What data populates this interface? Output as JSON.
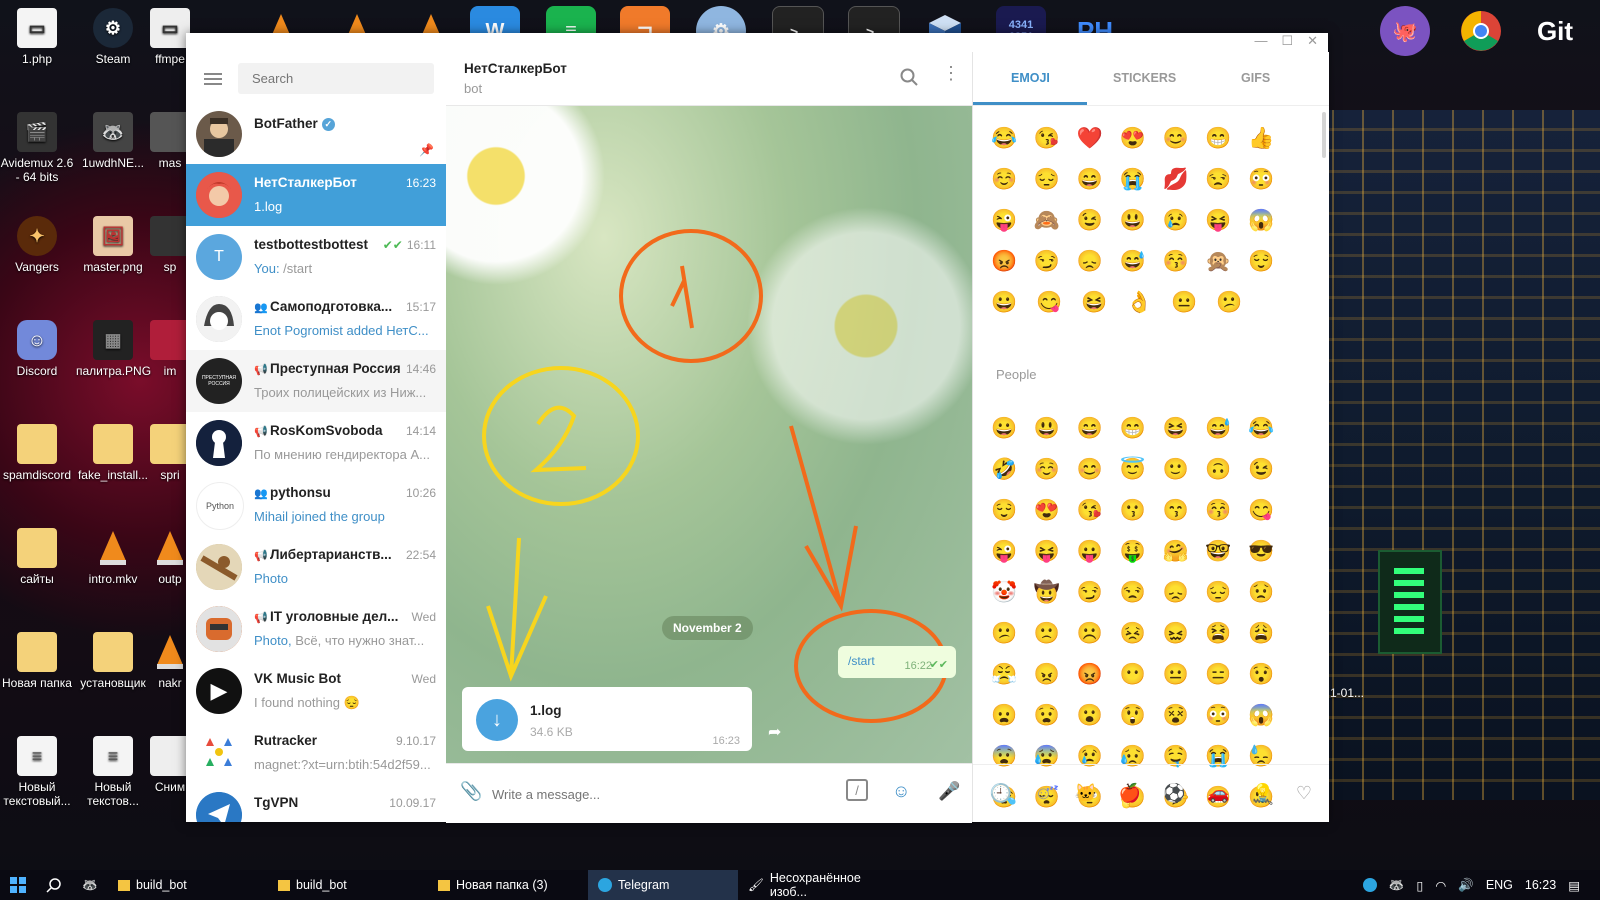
{
  "desktop": {
    "icons_left": [
      {
        "label": "1.php",
        "icon": "file-icon"
      },
      {
        "label": "Steam",
        "icon": "steam-icon"
      },
      {
        "label": "ffmpe",
        "icon": "file-icon"
      },
      {
        "label": "Avidemux 2.6 - 64 bits",
        "icon": "clapper-icon"
      },
      {
        "label": "1uwdhNE...",
        "icon": "image-icon"
      },
      {
        "label": "mas",
        "icon": "file-icon"
      },
      {
        "label": "Vangers",
        "icon": "game-icon"
      },
      {
        "label": "master.png",
        "icon": "image-icon"
      },
      {
        "label": "sp",
        "icon": "file-icon"
      },
      {
        "label": "Discord",
        "icon": "discord-icon"
      },
      {
        "label": "палитра.PNG",
        "icon": "image-icon"
      },
      {
        "label": "im",
        "icon": "file-icon"
      },
      {
        "label": "spamdiscord",
        "icon": "folder-icon"
      },
      {
        "label": "fake_install...",
        "icon": "folder-icon"
      },
      {
        "label": "spri",
        "icon": "folder-icon"
      },
      {
        "label": "сайты",
        "icon": "folder-icon"
      },
      {
        "label": "intro.mkv",
        "icon": "vlc-icon"
      },
      {
        "label": "outp",
        "icon": "vlc-icon"
      },
      {
        "label": "Новая папка",
        "icon": "folder-icon"
      },
      {
        "label": "установщик",
        "icon": "folder-icon"
      },
      {
        "label": "nakr",
        "icon": "vlc-icon"
      },
      {
        "label": "Новый текстовый...",
        "icon": "file-icon"
      },
      {
        "label": "Новый текстов...",
        "icon": "file-icon"
      },
      {
        "label": "Сним",
        "icon": "file-icon"
      }
    ],
    "right_label": "1-01...",
    "top_icon_git": "Git",
    "top_icon_numbers": "4341 6851"
  },
  "telegram": {
    "search_placeholder": "Search",
    "chats": [
      {
        "name": "BotFather",
        "time": "",
        "preview": "",
        "verified": true,
        "pinned": true,
        "avatar_color": "#6b5a4a",
        "avatar_text": ""
      },
      {
        "name": "НетСталкерБот",
        "time": "16:23",
        "preview": "1.log",
        "active": true,
        "avatar_color": "#d9534f",
        "avatar_text": ""
      },
      {
        "name": "testbottestbottest",
        "time": "16:11",
        "preview_prefix": "You:",
        "preview": " /start",
        "avatar_color": "#5ba7de",
        "avatar_text": "T"
      },
      {
        "name": "Самоподготовка...",
        "time": "15:17",
        "preview": "Enot Pogromist added НетС...",
        "type": "group",
        "avatar_color": "#cccccc",
        "avatar_text": ""
      },
      {
        "name": "Преступная Россия",
        "time": "14:46",
        "preview": "Троих полицейских из Ниж...",
        "type": "channel",
        "avatar_color": "#222222",
        "avatar_text": "ПРЕСТУПНАЯ РОССИЯ"
      },
      {
        "name": "RosKomSvoboda",
        "time": "14:14",
        "preview": "По мнению гендиректора А...",
        "type": "channel",
        "avatar_color": "#1b2a4a",
        "avatar_text": ""
      },
      {
        "name": "pythonsu",
        "time": "10:26",
        "preview": "Mihail joined the group",
        "type": "group",
        "avatar_color": "#ffffff",
        "avatar_text": "Python"
      },
      {
        "name": "Либертарианств...",
        "time": "22:54",
        "preview": "Photo",
        "type": "channel",
        "avatar_color": "#c9b48a",
        "avatar_text": ""
      },
      {
        "name": "IT уголовные дел...",
        "time": "Wed",
        "preview_prefix": "Photo,",
        "preview": " Всё, что нужно знат...",
        "type": "channel",
        "avatar_color": "#d96b2e",
        "avatar_text": ""
      },
      {
        "name": "VK Music Bot",
        "time": "Wed",
        "preview": "I found nothing 😔",
        "avatar_color": "#111111",
        "avatar_text": "▶"
      },
      {
        "name": "Rutracker",
        "time": "9.10.17",
        "preview": "magnet:?xt=urn:btih:54d2f59...",
        "avatar_color": "#ffffff",
        "avatar_text": ""
      },
      {
        "name": "TgVPN",
        "time": "10.09.17",
        "preview": "",
        "avatar_color": "#2a78c4",
        "avatar_text": ""
      }
    ],
    "chat": {
      "title": "НетСталкерБот",
      "subtitle": "bot",
      "date_separator": "November 2",
      "messages": [
        {
          "direction": "out",
          "text": "/start",
          "time": "16:22",
          "read": true
        },
        {
          "direction": "in",
          "file_name": "1.log",
          "file_size": "34.6 KB",
          "time": "16:23"
        }
      ],
      "compose_placeholder": "Write a message...",
      "annotations": [
        "1",
        "2"
      ]
    },
    "emoji_panel": {
      "tabs": [
        "EMOJI",
        "STICKERS",
        "GIFS"
      ],
      "active_tab": "EMOJI",
      "recent": [
        [
          "😂",
          "😘",
          "❤️",
          "😍",
          "😊",
          "😁",
          "👍"
        ],
        [
          "☺️",
          "😔",
          "😄",
          "😭",
          "💋",
          "😒",
          "😳"
        ],
        [
          "😜",
          "🙈",
          "😉",
          "😃",
          "😢",
          "😝",
          "😱"
        ],
        [
          "😡",
          "😏",
          "😞",
          "😅",
          "😚",
          "🙊",
          "😌"
        ],
        [
          "😀",
          "😋",
          "😆",
          "👌",
          "😐",
          "😕"
        ]
      ],
      "people_label": "People",
      "people": [
        [
          "😀",
          "😃",
          "😄",
          "😁",
          "😆",
          "😅",
          "😂"
        ],
        [
          "🤣",
          "☺️",
          "😊",
          "😇",
          "🙂",
          "🙃",
          "😉"
        ],
        [
          "😌",
          "😍",
          "😘",
          "😗",
          "😙",
          "😚",
          "😋"
        ],
        [
          "😜",
          "😝",
          "😛",
          "🤑",
          "🤗",
          "🤓",
          "😎"
        ],
        [
          "🤡",
          "🤠",
          "😏",
          "😒",
          "😞",
          "😔",
          "😟"
        ],
        [
          "😕",
          "🙁",
          "☹️",
          "😣",
          "😖",
          "😫",
          "😩"
        ],
        [
          "😤",
          "😠",
          "😡",
          "😶",
          "😐",
          "😑",
          "😯"
        ],
        [
          "😦",
          "😧",
          "😮",
          "😲",
          "😵",
          "😳",
          "😱"
        ],
        [
          "😨",
          "😰",
          "😢",
          "😥",
          "🤤",
          "😭",
          "😓"
        ],
        [
          "😪",
          "😴",
          "🙄",
          "🤔",
          "🤥",
          "😬",
          "🤐"
        ]
      ]
    }
  },
  "taskbar": {
    "items": [
      {
        "label": "build_bot",
        "icon": "folder-icon"
      },
      {
        "label": "build_bot",
        "icon": "folder-icon"
      },
      {
        "label": "Новая папка (3)",
        "icon": "folder-icon"
      },
      {
        "label": "Telegram",
        "icon": "telegram-icon",
        "active": true
      },
      {
        "label": "Несохранённое изоб...",
        "icon": "paint-icon"
      }
    ],
    "lang": "ENG",
    "clock": "16:23"
  }
}
